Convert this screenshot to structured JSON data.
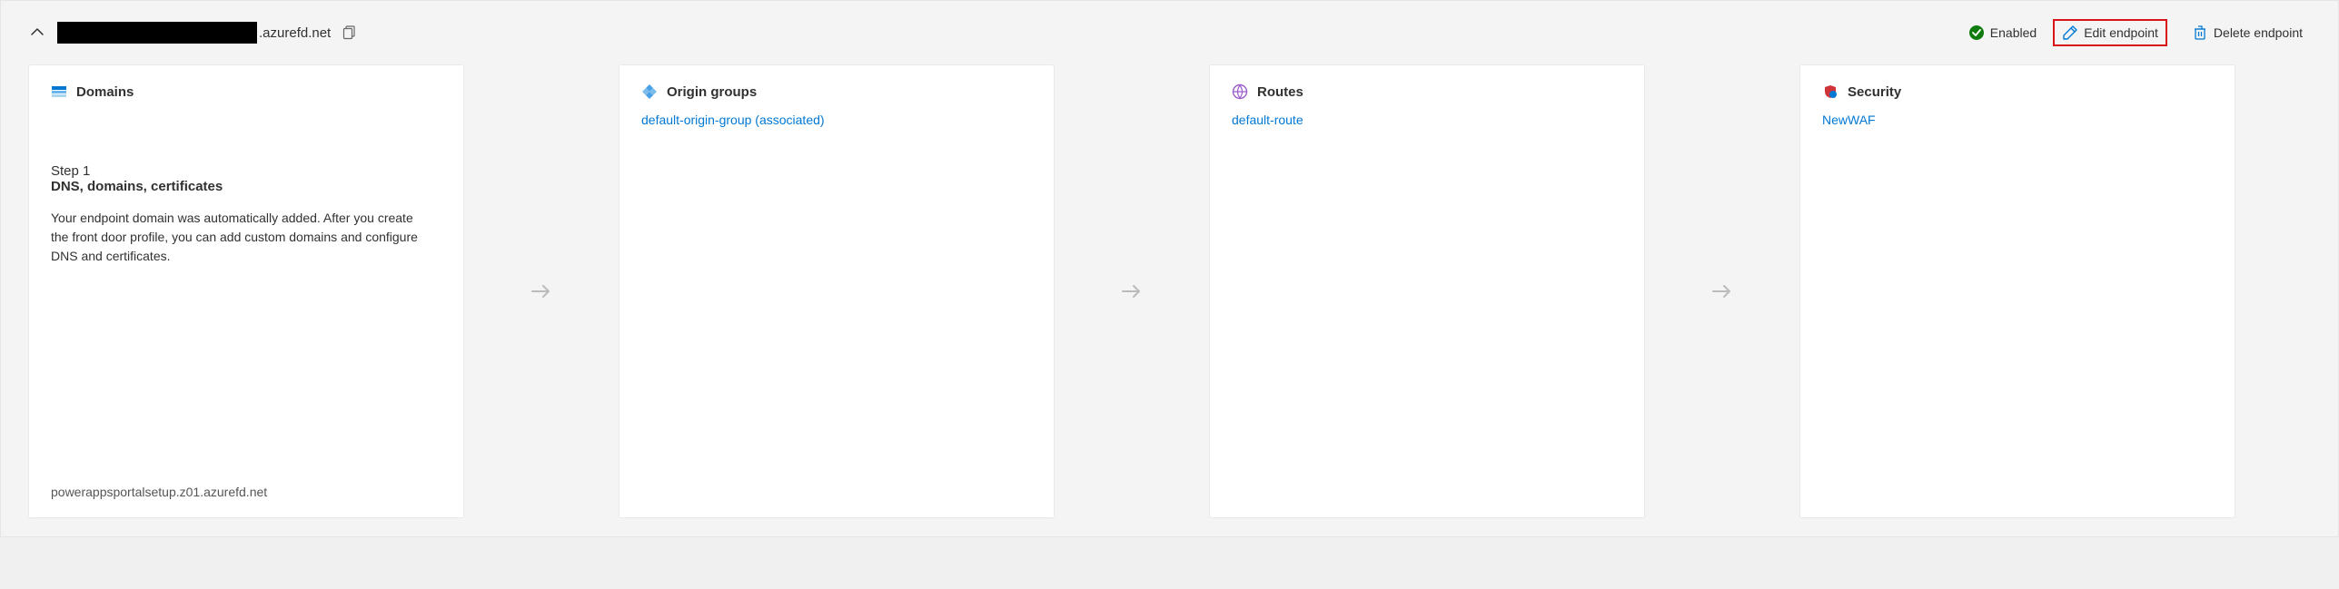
{
  "header": {
    "domain_suffix": ".azurefd.net",
    "status_label": "Enabled",
    "edit_label": "Edit endpoint",
    "delete_label": "Delete endpoint"
  },
  "cards": {
    "domains": {
      "title": "Domains",
      "step_label": "Step 1",
      "step_title": "DNS, domains, certificates",
      "step_desc": "Your endpoint domain was automatically added. After you create the front door profile, you can add custom domains and configure DNS and certificates.",
      "footer": "powerappsportalsetup.z01.azurefd.net"
    },
    "origin_groups": {
      "title": "Origin groups",
      "link": "default-origin-group (associated)"
    },
    "routes": {
      "title": "Routes",
      "link": "default-route"
    },
    "security": {
      "title": "Security",
      "link": "NewWAF"
    }
  }
}
